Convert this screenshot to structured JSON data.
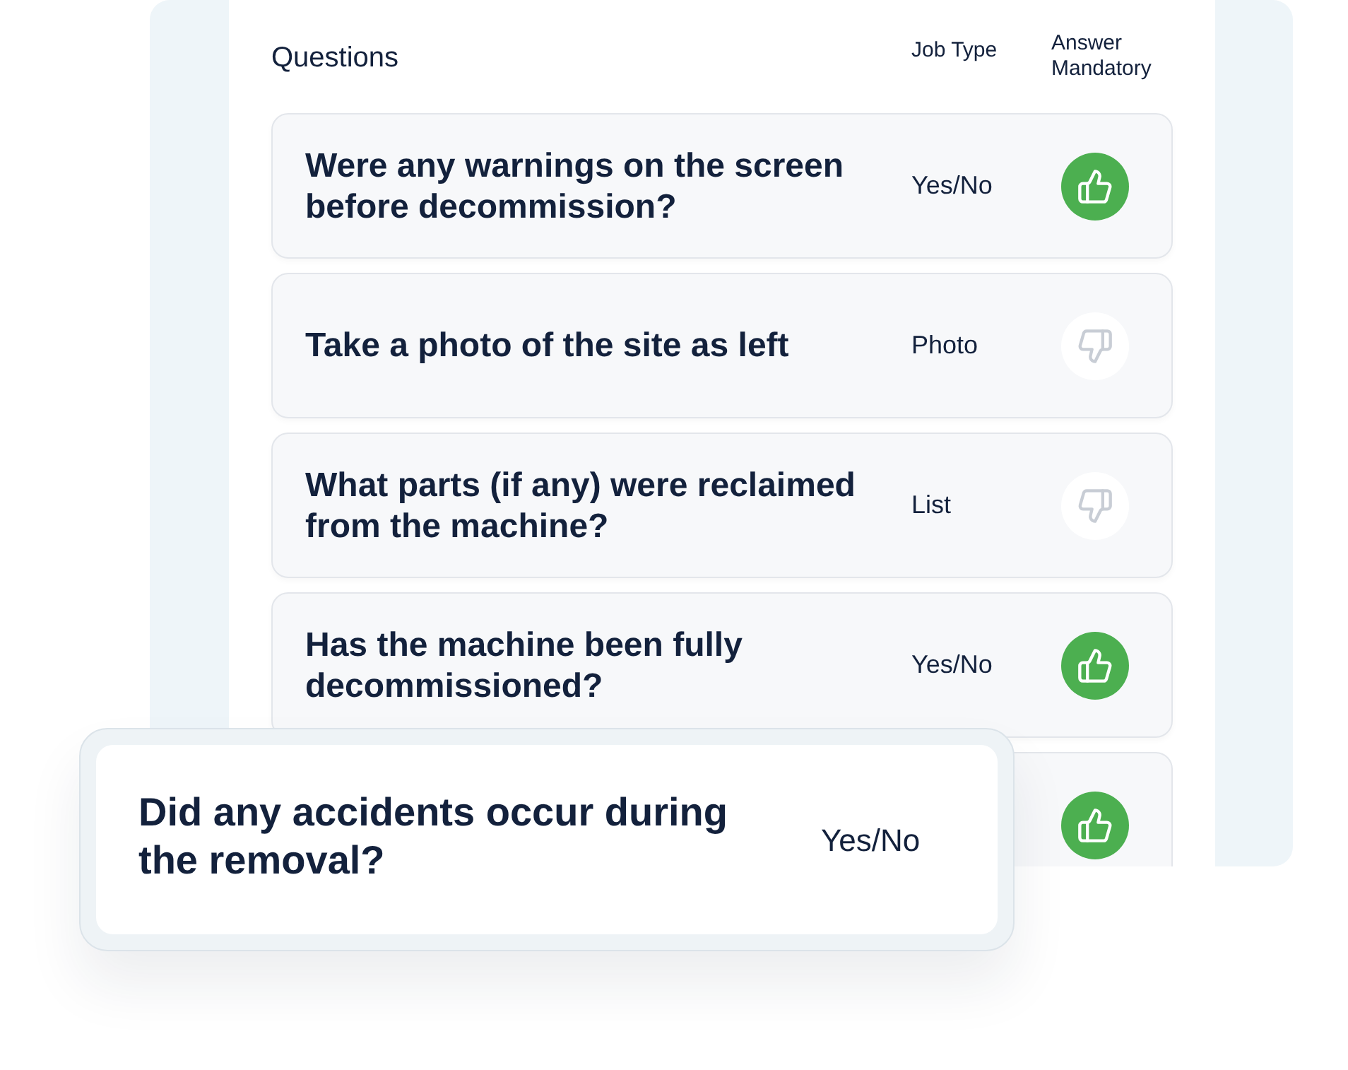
{
  "header": {
    "title": "Questions",
    "columns": [
      "Job Type",
      "Answer Mandatory"
    ]
  },
  "rows": [
    {
      "question": "Were any warnings on the screen before decommission?",
      "job_type": "Yes/No",
      "mandatory": true
    },
    {
      "question": "Take a photo of the site as left",
      "job_type": "Photo",
      "mandatory": false
    },
    {
      "question": "What parts (if any) were reclaimed from the machine?",
      "job_type": "List",
      "mandatory": false
    },
    {
      "question": "Has the machine been fully decommissioned?",
      "job_type": "Yes/No",
      "mandatory": true
    }
  ],
  "dragged_row": {
    "question": "Did any accidents occur during the removal?",
    "job_type": "Yes/No",
    "mandatory": true
  }
}
